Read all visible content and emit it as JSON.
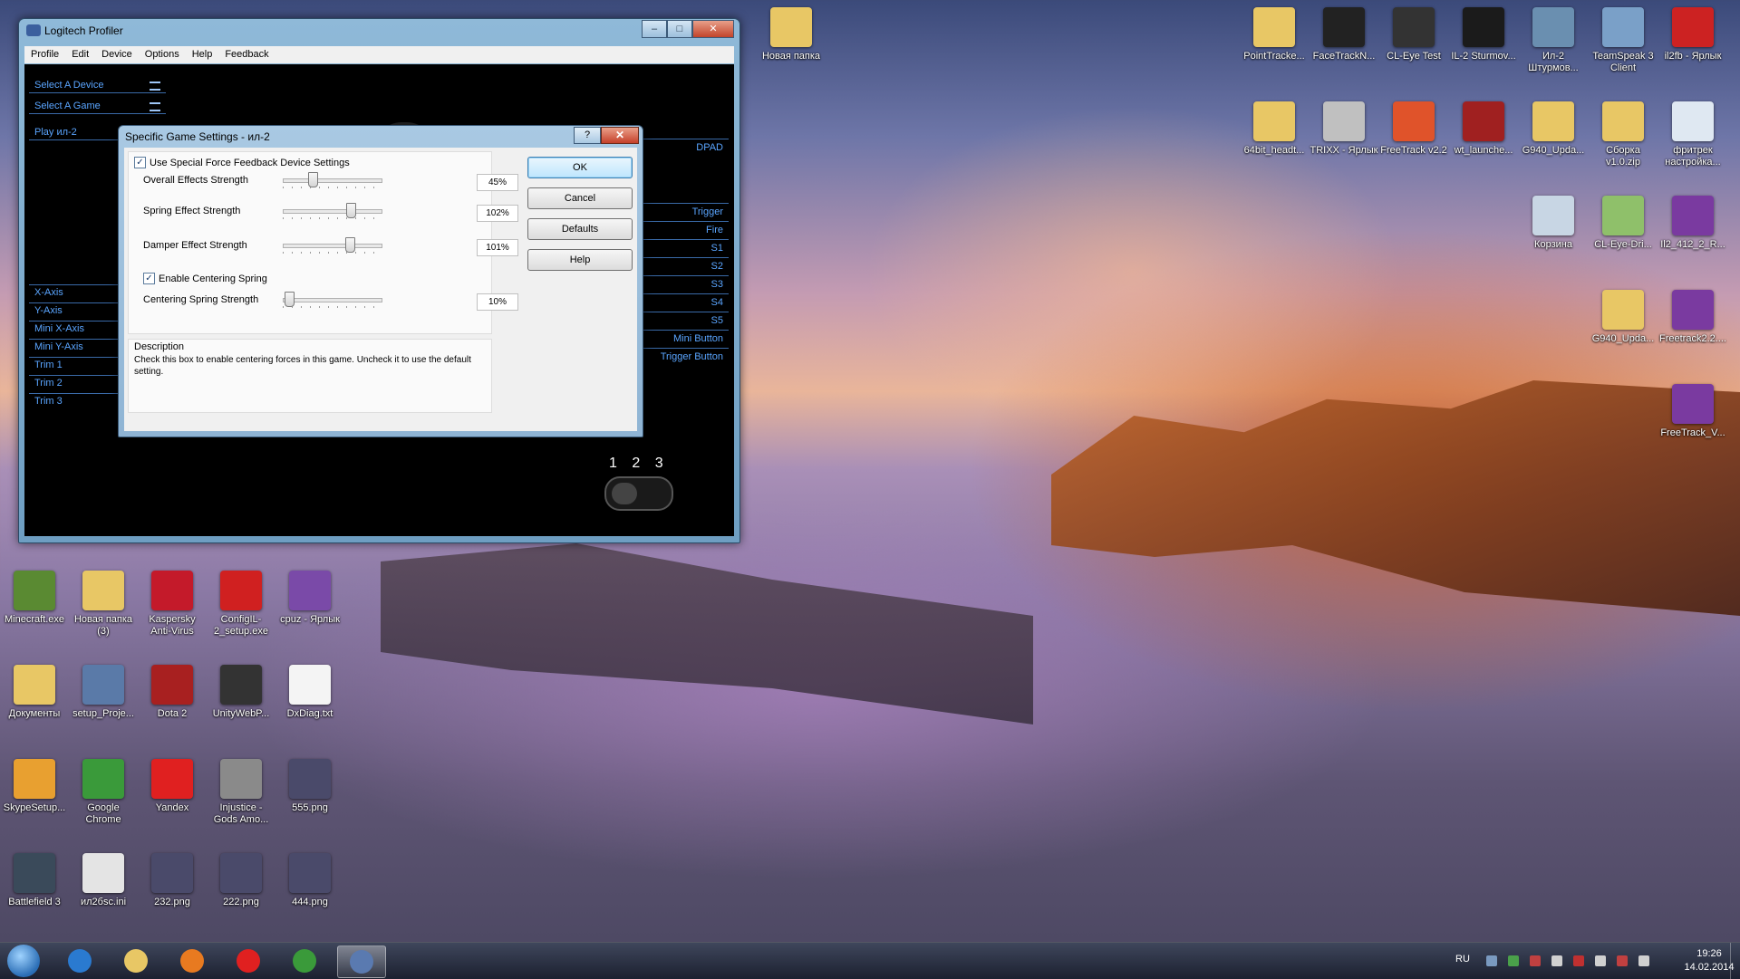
{
  "window": {
    "title": "Logitech Profiler",
    "menu": [
      "Profile",
      "Edit",
      "Device",
      "Options",
      "Help",
      "Feedback"
    ],
    "nav": [
      "Select A Device",
      "Select A Game",
      "Play ил-2"
    ],
    "axes": [
      "X-Axis",
      "Y-Axis",
      "Mini X-Axis",
      "Mini Y-Axis",
      "Trim 1",
      "Trim 2",
      "Trim 3"
    ],
    "buttons": [
      "DPAD",
      "Trigger",
      "Fire",
      "S1",
      "S2",
      "S3",
      "S4",
      "S5",
      "Mini Button",
      "Trigger Button"
    ],
    "mode_numbers": "1 2 3"
  },
  "dialog": {
    "title": "Specific Game Settings - ил-2",
    "help_glyph": "?",
    "close_glyph": "✕",
    "use_special_label": "Use Special Force Feedback Device Settings",
    "use_special_checked": true,
    "overall": {
      "label": "Overall Effects Strength",
      "value": "45%",
      "level": 45
    },
    "spring": {
      "label": "Spring Effect Strength",
      "value": "102%",
      "level": 102
    },
    "damper": {
      "label": "Damper Effect Strength",
      "value": "101%",
      "level": 101
    },
    "centering_enable_label": "Enable Centering Spring",
    "centering_checked": true,
    "centering": {
      "label": "Centering Spring Strength",
      "value": "10%",
      "level": 10
    },
    "description_title": "Description",
    "description_text": "Check this box to enable centering forces in this game. Uncheck it to use the default setting.",
    "ok": "OK",
    "cancel": "Cancel",
    "defaults": "Defaults",
    "help": "Help"
  },
  "desktop_right": [
    {
      "label": "PointTracke...",
      "color": "#e8c765"
    },
    {
      "label": "FaceTrackN...",
      "color": "#222222"
    },
    {
      "label": "CL-Eye Test",
      "color": "#333333"
    },
    {
      "label": "IL-2 Sturmov...",
      "color": "#1b1b1b"
    },
    {
      "label": "Ил-2 Штурмов...",
      "color": "#6a8fb0"
    },
    {
      "label": "TeamSpeak 3 Client",
      "color": "#7aa0c8"
    },
    {
      "label": "il2fb - Ярлык",
      "color": "#cc2222"
    },
    {
      "label": "64bit_headt...",
      "color": "#e8c765"
    },
    {
      "label": "TRIXX - Ярлык",
      "color": "#c0c0c0"
    },
    {
      "label": "FreeTrack v2.2",
      "color": "#e0532a"
    },
    {
      "label": "wt_launche...",
      "color": "#a02020"
    },
    {
      "label": "G940_Upda...",
      "color": "#e8c765"
    },
    {
      "label": "Сборка v1.0.zip",
      "color": "#e8c765"
    },
    {
      "label": "фритрек настройка...",
      "color": "#dfe8f2"
    },
    {
      "label": "Корзина",
      "color": "#c8d6e4"
    },
    {
      "label": "CL-Eye-Dri...",
      "color": "#8fc06a"
    },
    {
      "label": "Il2_412_2_R...",
      "color": "#7a3aa0"
    },
    {
      "label": "G940_Upda...",
      "color": "#e8c765"
    },
    {
      "label": "Freetrack2.2....",
      "color": "#7a3aa0"
    },
    {
      "label": "FreeTrack_V...",
      "color": "#7a3aa0"
    }
  ],
  "desktop_top": [
    {
      "label": "Новая папка",
      "color": "#e8c765"
    }
  ],
  "desktop_left": [
    {
      "label": "Minecraft.exe",
      "color": "#5a8a32"
    },
    {
      "label": "Новая папка (3)",
      "color": "#e8c765"
    },
    {
      "label": "Kaspersky Anti-Virus",
      "color": "#c41a2a"
    },
    {
      "label": "ConfigIL-2_setup.exe",
      "color": "#d02020"
    },
    {
      "label": "cpuz - Ярлык",
      "color": "#7a4aa8"
    },
    {
      "label": "Документы",
      "color": "#e8c765"
    },
    {
      "label": "setup_Proje...",
      "color": "#5a7aa8"
    },
    {
      "label": "Dota 2",
      "color": "#a82020"
    },
    {
      "label": "UnityWebP...",
      "color": "#333333"
    },
    {
      "label": "DxDiag.txt",
      "color": "#f4f4f4"
    },
    {
      "label": "SkypeSetup...",
      "color": "#e8a030"
    },
    {
      "label": "Google Chrome",
      "color": "#3a9a3a"
    },
    {
      "label": "Yandex",
      "color": "#e02020"
    },
    {
      "label": "Injustice - Gods Amo...",
      "color": "#8a8a8a"
    },
    {
      "label": "555.png",
      "color": "#4a4a6a"
    },
    {
      "label": "Battlefield 3",
      "color": "#3a4a5a"
    },
    {
      "label": "ил2бsc.ini",
      "color": "#e4e4e4"
    },
    {
      "label": "232.png",
      "color": "#4a4a6a"
    },
    {
      "label": "222.png",
      "color": "#4a4a6a"
    },
    {
      "label": "444.png",
      "color": "#4a4a6a"
    }
  ],
  "taskbar": {
    "apps": [
      {
        "name": "ie",
        "color": "#2a7ad0"
      },
      {
        "name": "explorer",
        "color": "#e8c765"
      },
      {
        "name": "media-player",
        "color": "#e87a20"
      },
      {
        "name": "yandex",
        "color": "#e02020"
      },
      {
        "name": "chrome",
        "color": "#3a9a3a"
      },
      {
        "name": "logitech-profiler",
        "color": "#5a7ab0"
      }
    ],
    "lang": "RU",
    "time": "19:26",
    "date": "14.02.2014"
  }
}
